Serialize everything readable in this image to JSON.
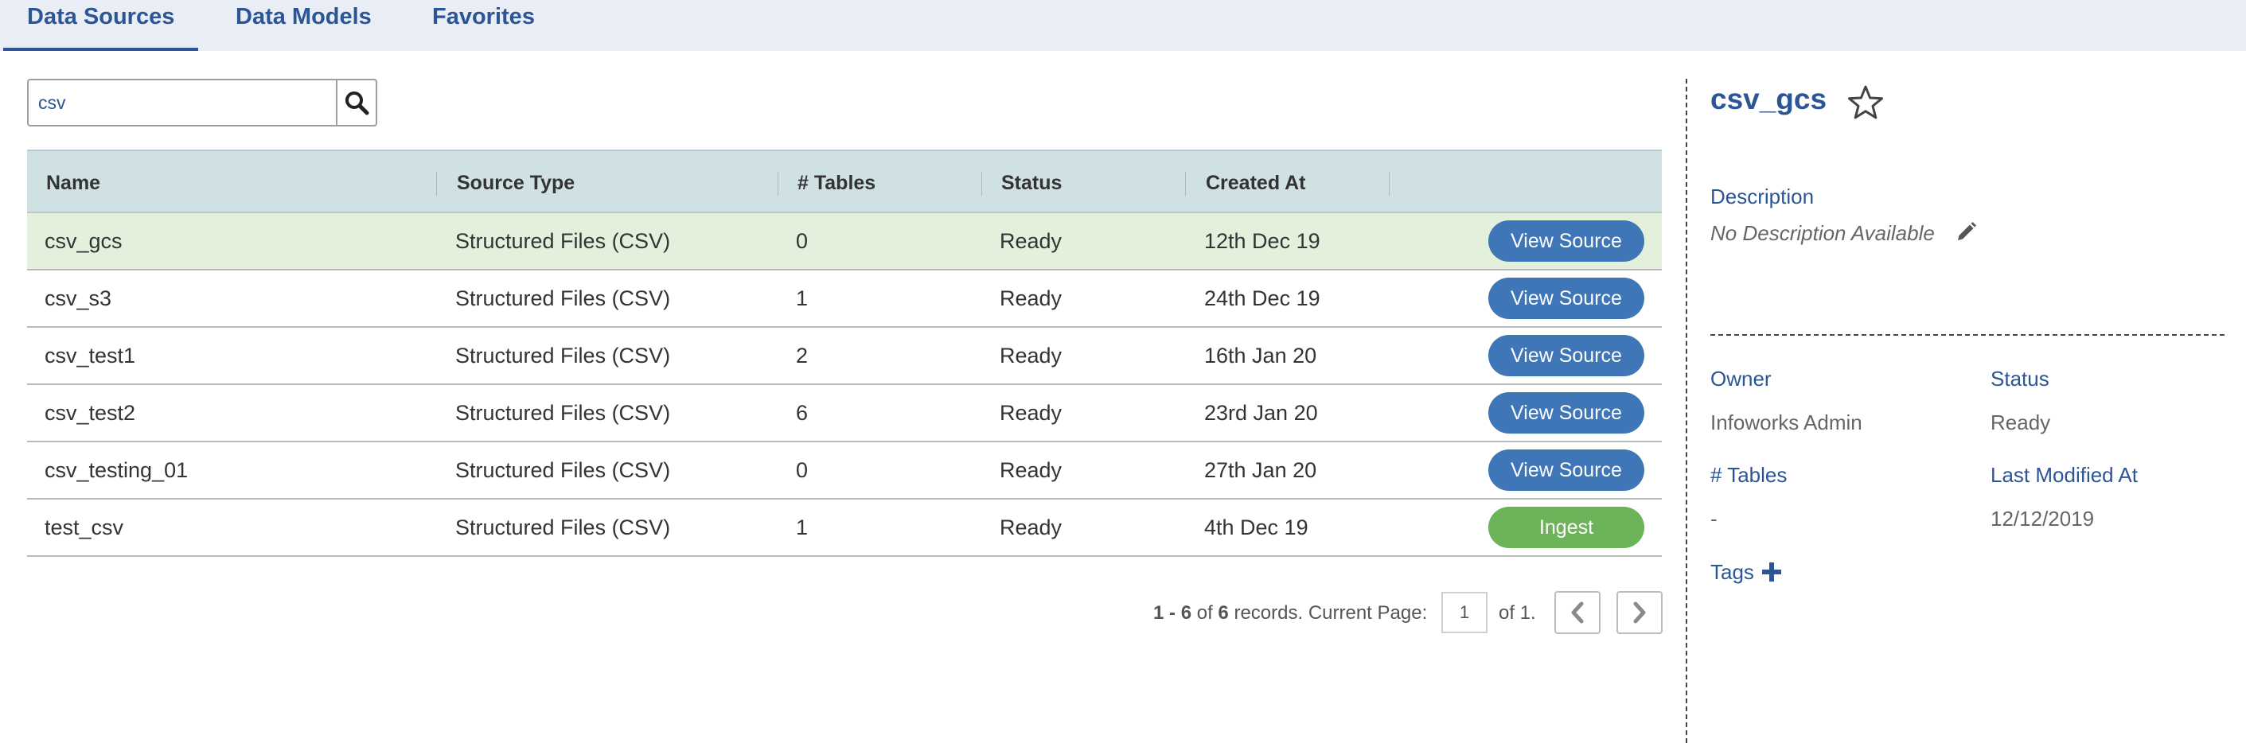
{
  "tabs": [
    {
      "label": "Data Sources",
      "active": true
    },
    {
      "label": "Data Models",
      "active": false
    },
    {
      "label": "Favorites",
      "active": false
    }
  ],
  "search": {
    "value": "csv",
    "placeholder": "",
    "icon": "search-icon"
  },
  "table": {
    "columns": [
      "Name",
      "Source Type",
      "# Tables",
      "Status",
      "Created At",
      ""
    ],
    "rows": [
      {
        "name": "csv_gcs",
        "type": "Structured Files (CSV)",
        "tables": "0",
        "status": "Ready",
        "created": "12th Dec 19",
        "action": "View Source",
        "selected": true
      },
      {
        "name": "csv_s3",
        "type": "Structured Files (CSV)",
        "tables": "1",
        "status": "Ready",
        "created": "24th Dec 19",
        "action": "View Source"
      },
      {
        "name": "csv_test1",
        "type": "Structured Files (CSV)",
        "tables": "2",
        "status": "Ready",
        "created": "16th Jan 20",
        "action": "View Source"
      },
      {
        "name": "csv_test2",
        "type": "Structured Files (CSV)",
        "tables": "6",
        "status": "Ready",
        "created": "23rd Jan 20",
        "action": "View Source"
      },
      {
        "name": "csv_testing_01",
        "type": "Structured Files (CSV)",
        "tables": "0",
        "status": "Ready",
        "created": "27th Jan 20",
        "action": "View Source"
      },
      {
        "name": "test_csv",
        "type": "Structured Files (CSV)",
        "tables": "1",
        "status": "Ready",
        "created": "4th Dec 19",
        "action": "Ingest"
      }
    ]
  },
  "pagination": {
    "range_start": "1",
    "range_end": "6",
    "total": "6",
    "records_label": "records. Current Page:",
    "current_page": "1",
    "of_label": "of 1."
  },
  "detail": {
    "title": "csv_gcs",
    "description_label": "Description",
    "description_value": "No Description Available",
    "owner_label": "Owner",
    "owner_value": "Infoworks Admin",
    "status_label": "Status",
    "status_value": "Ready",
    "tables_label": "# Tables",
    "tables_value": "-",
    "last_modified_label": "Last Modified At",
    "last_modified_value": "12/12/2019",
    "tags_label": "Tags"
  },
  "colors": {
    "accent": "#2c5596",
    "button_blue": "#3f76b8",
    "button_green": "#6cb35a",
    "header_bg": "#d0e1e4",
    "selected_row": "#e2f0dc"
  }
}
